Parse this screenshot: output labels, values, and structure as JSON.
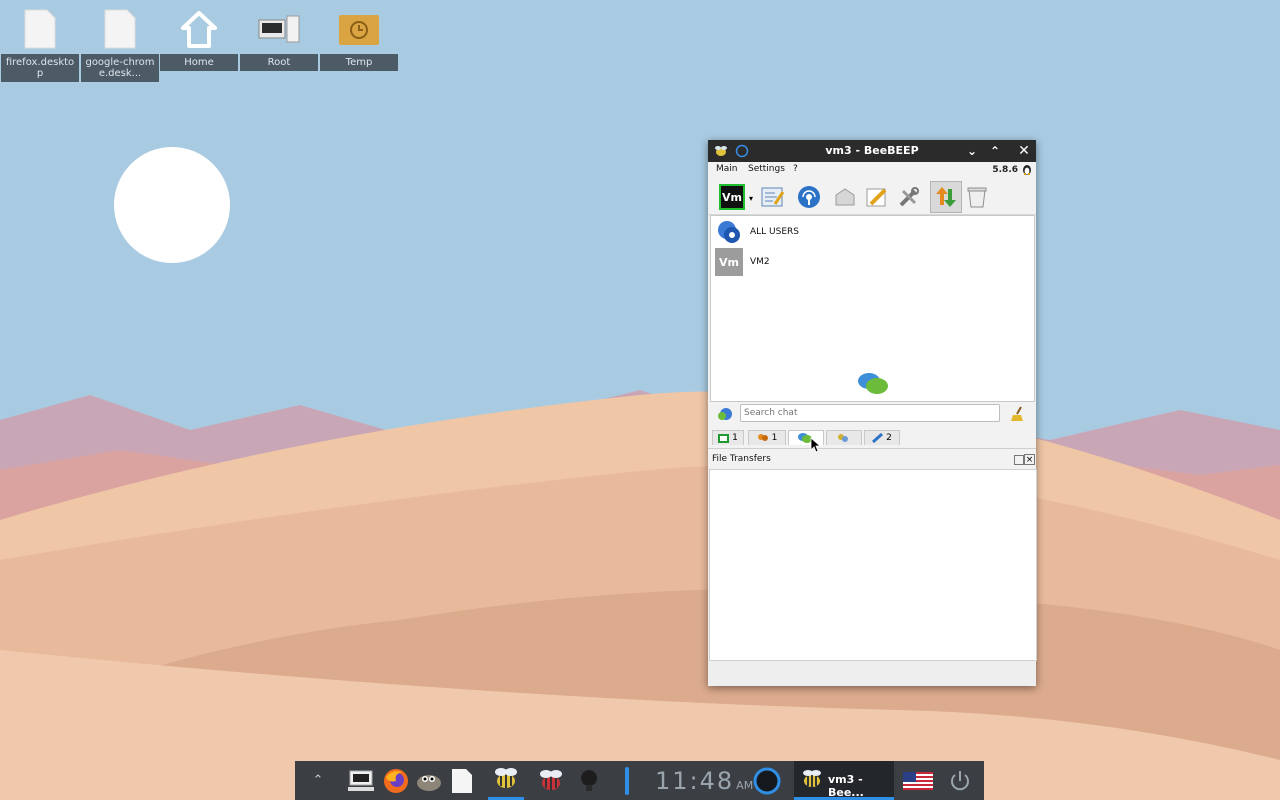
{
  "desktop": {
    "icons": [
      {
        "label": "firefox.desktop",
        "icon": "file-icon"
      },
      {
        "label": "google-chrome.desk...",
        "icon": "file-icon"
      },
      {
        "label": "Home",
        "icon": "home-icon"
      },
      {
        "label": "Root",
        "icon": "computer-icon"
      },
      {
        "label": "Temp",
        "icon": "folder-icon"
      }
    ]
  },
  "window": {
    "title": "vm3 - BeeBEEP",
    "menu": {
      "main": "Main",
      "settings": "Settings",
      "help": "?"
    },
    "version": "5.8.6",
    "users": [
      {
        "name": "ALL USERS",
        "icon": "all-users-icon"
      },
      {
        "name": "VM2",
        "avatar_text": "Vm"
      }
    ],
    "toolbar_avatar": "Vm",
    "search_placeholder": "Search chat",
    "tabs": [
      {
        "icon": "user-list-icon",
        "count": "1"
      },
      {
        "icon": "groups-icon",
        "count": "1"
      },
      {
        "icon": "chats-icon",
        "count": ""
      },
      {
        "icon": "shares-icon",
        "count": ""
      },
      {
        "icon": "messages-icon",
        "count": "2"
      }
    ],
    "file_transfers_title": "File Transfers"
  },
  "taskbar": {
    "clock": "11:48",
    "ampm": "AM",
    "active_task_label": "vm3 - Bee...",
    "colors": {
      "accent": "#2f8fe6"
    }
  }
}
